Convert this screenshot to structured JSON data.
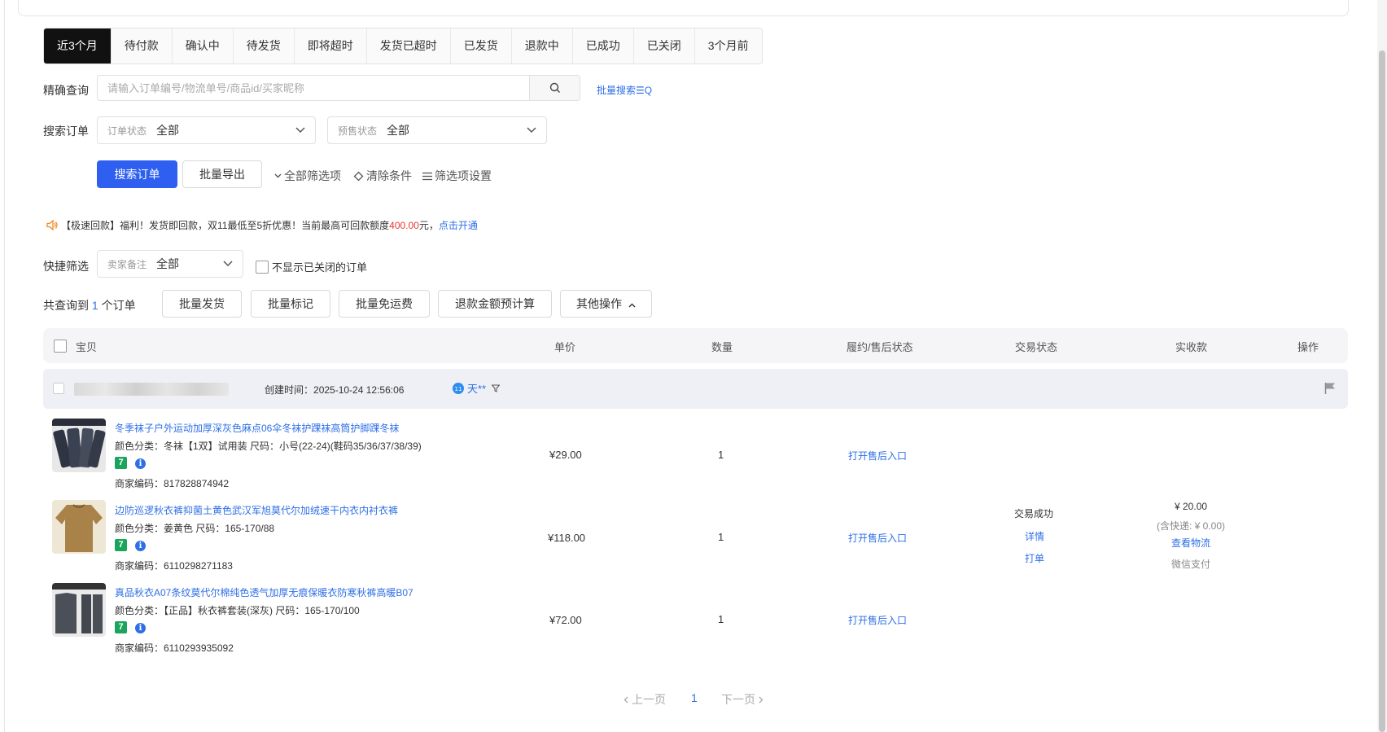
{
  "tabs": [
    "近3个月",
    "待付款",
    "确认中",
    "待发货",
    "即将超时",
    "发货已超时",
    "已发货",
    "退款中",
    "已成功",
    "已关闭",
    "3个月前"
  ],
  "search": {
    "label": "精确查询",
    "placeholder": "请输入订单编号/物流单号/商品id/买家昵称",
    "batch_search": "批量搜索☰Q"
  },
  "filters": {
    "label": "搜索订单",
    "order_status": {
      "label": "订单状态",
      "value": "全部"
    },
    "presale_status": {
      "label": "预售状态",
      "value": "全部"
    }
  },
  "actions": {
    "search_orders": "搜索订单",
    "batch_export": "批量导出",
    "all_filters": "全部筛选项",
    "clear_conditions": "清除条件",
    "filter_settings": "筛选项设置"
  },
  "notice": {
    "prefix": "【极速回款】福利！发货即回款，双11最低至5折优惠！当前最高可回款额度",
    "amount": "400.00",
    "suffix": "元，",
    "link": "点击开通"
  },
  "quick_filter": {
    "label": "快捷筛选",
    "seller_note": {
      "label": "卖家备注",
      "value": "全部"
    },
    "hide_closed": "不显示已关闭的订单"
  },
  "summary": {
    "prefix": "共查询到",
    "count": "1",
    "suffix": "个订单"
  },
  "batch_buttons": {
    "ship": "批量发货",
    "mark": "批量标记",
    "free_shipping": "批量免运费",
    "refund_calc": "退款金额预计算",
    "other": "其他操作"
  },
  "table_headers": {
    "item": "宝贝",
    "price": "单价",
    "quantity": "数量",
    "after_sale": "履约/售后状态",
    "trade_status": "交易状态",
    "received": "实收款",
    "operation": "操作"
  },
  "order": {
    "created_label": "创建时间：",
    "created_time": "2025-10-24 12:56:06",
    "buyer": "天**",
    "trade_status": "交易成功",
    "detail_link": "详情",
    "print_link": "打单",
    "received": "¥ 20.00",
    "shipping_note": "(含快递: ¥ 0.00)",
    "view_logistics": "查看物流",
    "payment": "微信支付"
  },
  "items": [
    {
      "title": "冬季袜子户外运动加厚深灰色麻点06伞冬袜护踝袜高筒护脚踝冬袜",
      "attrs": "颜色分类：冬袜【1双】试用装  尺码：小号(22-24)(鞋码35/36/37/38/39)",
      "sku": "商家编码：817828874942",
      "price": "¥29.00",
      "qty": "1",
      "after_sale_link": "打开售后入口",
      "img_color": "#3a4150"
    },
    {
      "title": "边防巡逻秋衣裤抑菌土黄色武汉军旭莫代尔加绒速干内衣内衬衣裤",
      "attrs": "颜色分类：姜黄色  尺码：165-170/88",
      "sku": "商家编码：6110298271183",
      "price": "¥118.00",
      "qty": "1",
      "after_sale_link": "打开售后入口",
      "img_color": "#a9824a"
    },
    {
      "title": "真品秋衣A07条纹莫代尔棉纯色透气加厚无痕保暖衣防寒秋裤高暖B07",
      "attrs": "颜色分类：【正品】秋衣裤套装(深灰)  尺码：165-170/100",
      "sku": "商家编码：6110293935092",
      "price": "¥72.00",
      "qty": "1",
      "after_sale_link": "打开售后入口",
      "img_color": "#4b4f57"
    }
  ],
  "pagination": {
    "prev": "上一页",
    "current": "1",
    "next": "下一页"
  }
}
